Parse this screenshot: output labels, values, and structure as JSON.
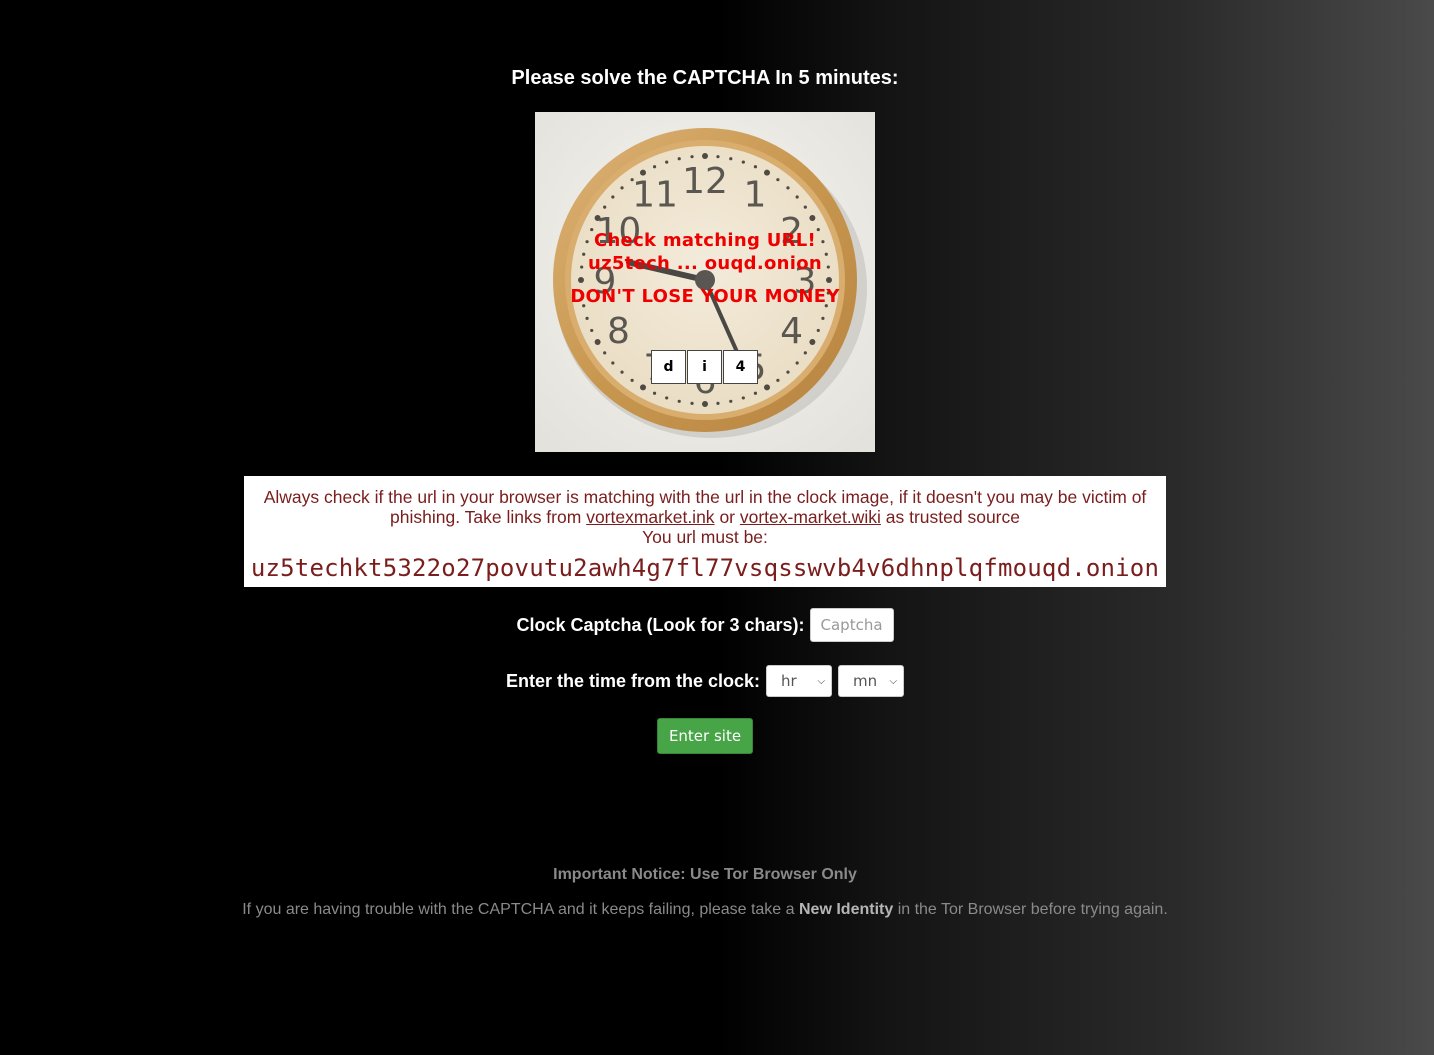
{
  "heading": "Please solve the CAPTCHA In 5 minutes:",
  "clock": {
    "warning_line_1": "Check matching URL!",
    "warning_line_2": "uz5tech ... ouqd.onion",
    "warning_line_3": "DON'T LOSE YOUR MONEY",
    "chars": [
      "d",
      "i",
      "4"
    ],
    "numerals": [
      "12",
      "1",
      "2",
      "3",
      "4",
      "5",
      "6",
      "7",
      "8",
      "9",
      "10",
      "11"
    ],
    "hand_hour": 9,
    "hand_minute": 26,
    "colors": {
      "frame": "#c99a5b",
      "face": "#efe4cf",
      "warning": "#ee0000"
    }
  },
  "notice": {
    "text_1": "Always check if the url in your browser is matching with the url in the clock image, if it doesn't you may be victim of phishing. Take links from",
    "link_1": "vortexmarket.ink",
    "text_or": "or",
    "link_2": "vortex-market.wiki",
    "text_2": "as trusted source",
    "must_be": "You url must be:",
    "onion_url": "uz5techkt5322o27povutu2awh4g7fl77vsqsswvb4v6dhnplqfmouqd.onion"
  },
  "form": {
    "captcha_label": "Clock Captcha (Look for 3 chars):",
    "captcha_placeholder": "Captcha",
    "time_label": "Enter the time from the clock:",
    "hour_selected": "hr",
    "minute_selected": "mn",
    "submit_label": "Enter site",
    "submit_color": "#47a447"
  },
  "footer": {
    "title": "Important Notice: Use Tor Browser Only",
    "text_1": "If you are having trouble with the CAPTCHA and it keeps failing, please take a",
    "bold": "New Identity",
    "text_2": "in the Tor Browser before trying again."
  }
}
